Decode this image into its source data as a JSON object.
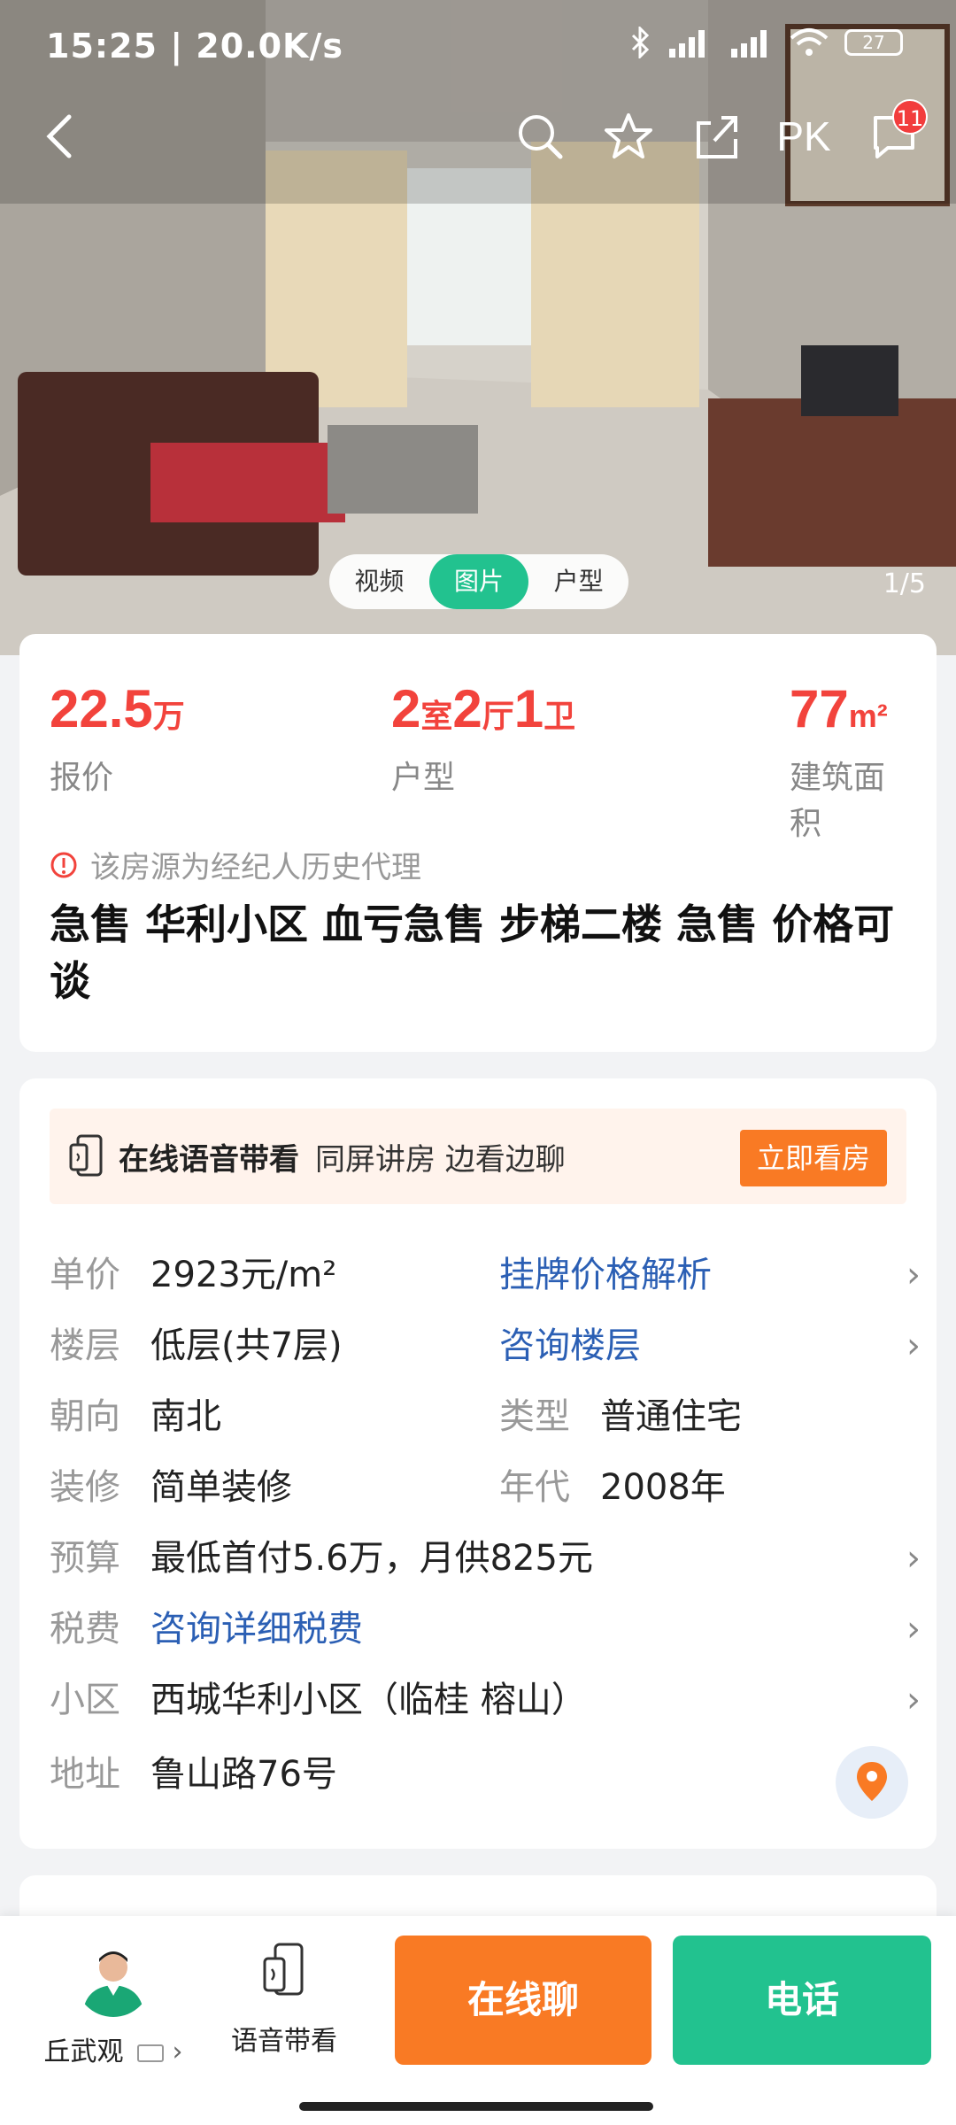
{
  "status_bar": {
    "time": "15:25 | 20.0K/s",
    "battery": "27"
  },
  "top_nav": {
    "pk_label": "PK",
    "message_badge": "11"
  },
  "media": {
    "tabs": [
      "视频",
      "图片",
      "户型"
    ],
    "active_tab": "图片",
    "counter": "1/5"
  },
  "summary": {
    "price_value": "22.5",
    "price_unit": "万",
    "price_label": "报价",
    "layout_n1": "2",
    "layout_u1": "室",
    "layout_n2": "2",
    "layout_u2": "厅",
    "layout_n3": "1",
    "layout_u3": "卫",
    "layout_label": "户型",
    "area_value": "77",
    "area_unit": "m²",
    "area_label": "建筑面积",
    "notice": "该房源为经纪人历史代理",
    "title": "急售 华利小区 血亏急售   步梯二楼  急售 价格可谈"
  },
  "banner": {
    "title": "在线语音带看",
    "subtitle": "同屏讲房 边看边聊",
    "button": "立即看房"
  },
  "details": {
    "unit_price_k": "单价",
    "unit_price_v": "2923元/m²",
    "price_analysis": "挂牌价格解析",
    "floor_k": "楼层",
    "floor_v": "低层(共7层)",
    "floor_consult": "咨询楼层",
    "orient_k": "朝向",
    "orient_v": "南北",
    "type_k": "类型",
    "type_v": "普通住宅",
    "decor_k": "装修",
    "decor_v": "简单装修",
    "year_k": "年代",
    "year_v": "2008年",
    "budget_k": "预算",
    "budget_v": "最低首付5.6万，月供825元",
    "tax_k": "税费",
    "tax_v": "咨询详细税费",
    "community_k": "小区",
    "community_v": "西城华利小区（临桂 榕山）",
    "address_k": "地址",
    "address_v": "鲁山路76号"
  },
  "bottom_bar": {
    "agent_name": "丘武观",
    "voice_label": "语音带看",
    "chat_button": "在线聊",
    "call_button": "电话"
  },
  "colors": {
    "price_red": "#f2433c",
    "accent_green": "#22c28f",
    "accent_orange": "#f97a24",
    "link_blue": "#2b5fb4"
  }
}
